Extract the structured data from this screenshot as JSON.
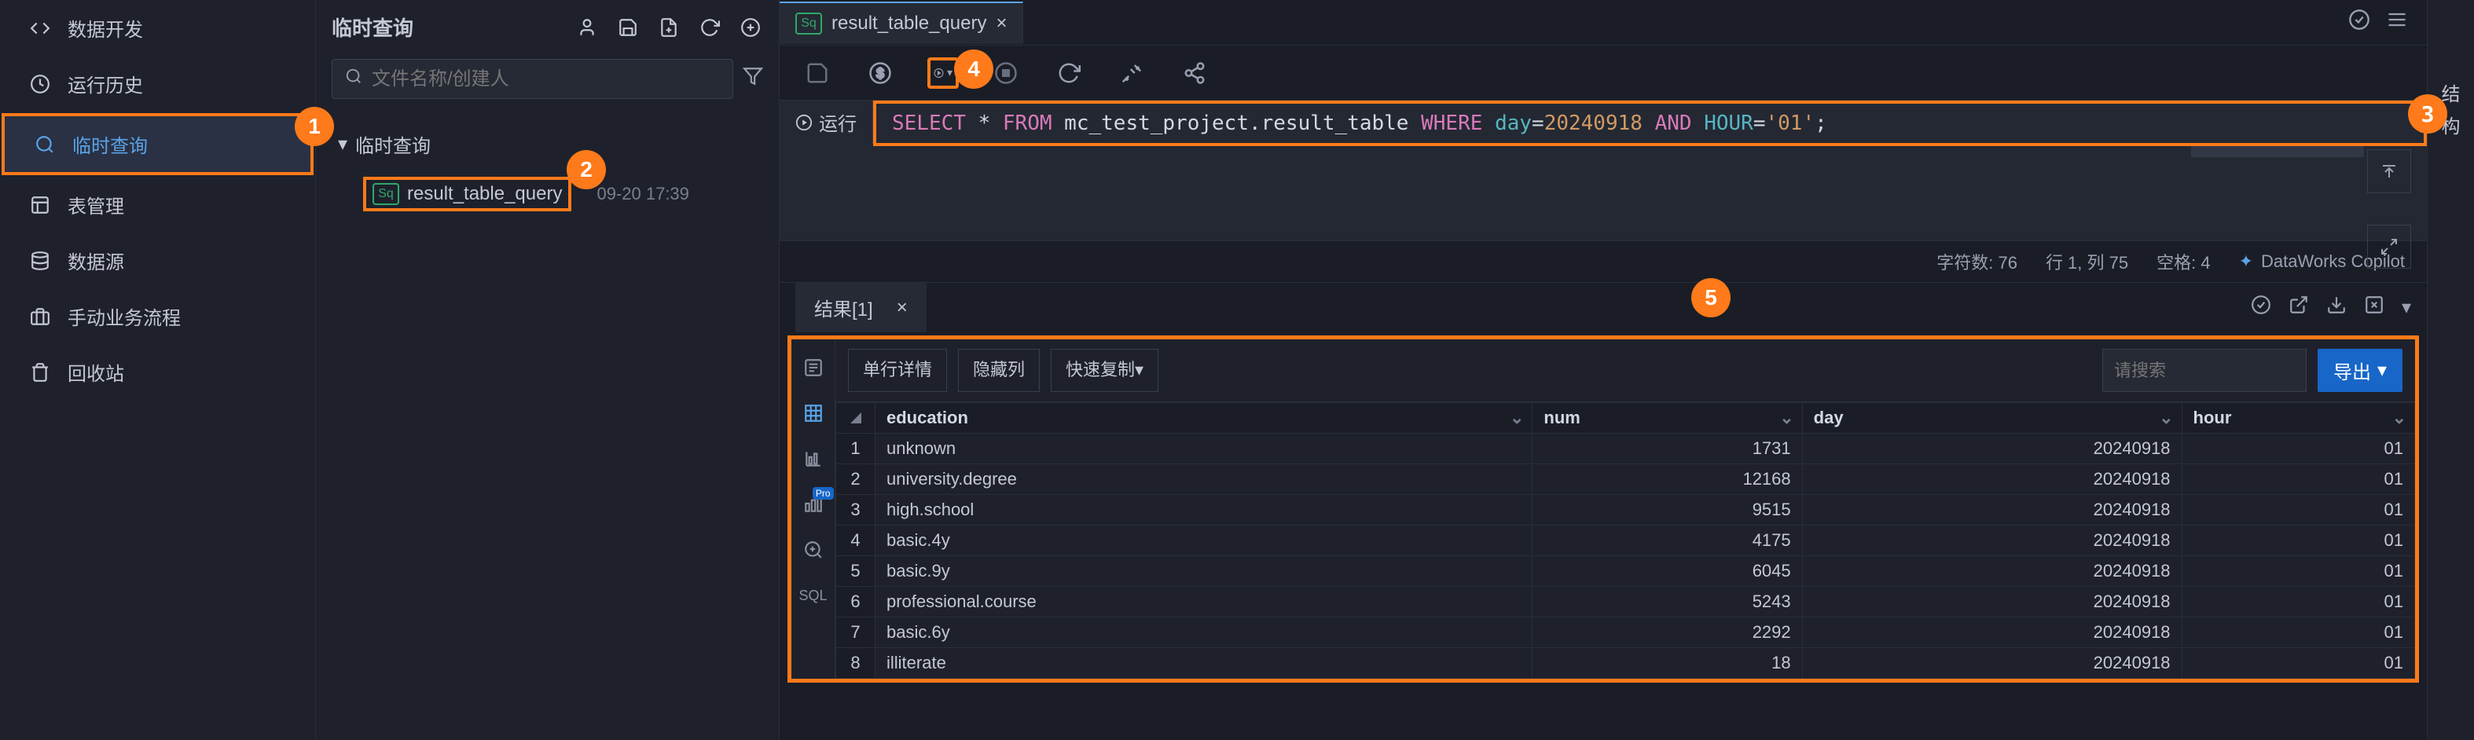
{
  "nav": {
    "items": [
      {
        "label": "数据开发",
        "icon": "code-icon"
      },
      {
        "label": "运行历史",
        "icon": "history-icon"
      },
      {
        "label": "临时查询",
        "icon": "search-icon"
      },
      {
        "label": "表管理",
        "icon": "table-icon"
      },
      {
        "label": "数据源",
        "icon": "datasource-icon"
      },
      {
        "label": "手动业务流程",
        "icon": "briefcase-icon"
      },
      {
        "label": "回收站",
        "icon": "trash-icon"
      }
    ]
  },
  "file_panel": {
    "title": "临时查询",
    "search_placeholder": "文件名称/创建人",
    "tree_root": "临时查询",
    "file_name": "result_table_query",
    "file_badge": "Sq",
    "file_timestamp": "09-20 17:39"
  },
  "tab": {
    "badge": "Sq",
    "name": "result_table_query"
  },
  "sql": {
    "run_label": "运行",
    "tokens": {
      "select": "SELECT",
      "star": "*",
      "from": "FROM",
      "table": "mc_test_project.result_table",
      "where": "WHERE",
      "col_day": "day",
      "eq1": "=",
      "val_day": "20240918",
      "and": "AND",
      "col_hour": "HOUR",
      "eq2": "=",
      "val_hour": "'01'",
      "semi": ";"
    }
  },
  "status_bar": {
    "chars": "字符数: 76",
    "pos": "行 1, 列 75",
    "spaces": "空格: 4",
    "copilot": "DataWorks Copilot"
  },
  "far_right": {
    "l1": "结",
    "l2": "构"
  },
  "results": {
    "tab_label": "结果[1]",
    "btn_detail": "单行详情",
    "btn_hide": "隐藏列",
    "btn_copy": "快速复制",
    "search_placeholder": "请搜索",
    "export": "导出",
    "columns": [
      "education",
      "num",
      "day",
      "hour"
    ],
    "rows": [
      {
        "idx": "1",
        "education": "unknown",
        "num": "1731",
        "day": "20240918",
        "hour": "01"
      },
      {
        "idx": "2",
        "education": "university.degree",
        "num": "12168",
        "day": "20240918",
        "hour": "01"
      },
      {
        "idx": "3",
        "education": "high.school",
        "num": "9515",
        "day": "20240918",
        "hour": "01"
      },
      {
        "idx": "4",
        "education": "basic.4y",
        "num": "4175",
        "day": "20240918",
        "hour": "01"
      },
      {
        "idx": "5",
        "education": "basic.9y",
        "num": "6045",
        "day": "20240918",
        "hour": "01"
      },
      {
        "idx": "6",
        "education": "professional.course",
        "num": "5243",
        "day": "20240918",
        "hour": "01"
      },
      {
        "idx": "7",
        "education": "basic.6y",
        "num": "2292",
        "day": "20240918",
        "hour": "01"
      },
      {
        "idx": "8",
        "education": "illiterate",
        "num": "18",
        "day": "20240918",
        "hour": "01"
      }
    ],
    "side_sql": "SQL"
  },
  "callouts": {
    "c1": "1",
    "c2": "2",
    "c3": "3",
    "c4": "4",
    "c5": "5"
  }
}
